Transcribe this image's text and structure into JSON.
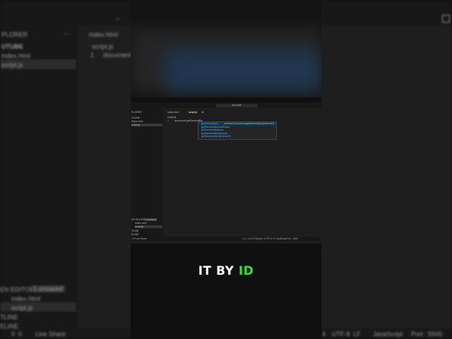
{
  "background": {
    "explorer_title": "PLORER",
    "folder_name": "UTUBE",
    "files": [
      "index.html",
      "script.js"
    ],
    "tab_label": "index.html",
    "breadcrumb": "script.js",
    "line_number": "1",
    "code": "document.",
    "open_editors_label": "EN EDITORS",
    "unsaved_badge": "1 unsaved",
    "open_editors_files": [
      "index.html",
      "script.js"
    ],
    "outline_label": "TLINE",
    "timeline_label": "ELINE",
    "status_left": [
      "0",
      "0",
      "Live Share"
    ],
    "status_right": [
      "4",
      "UTF-8",
      "LF",
      "JavaScript",
      "Port : 5500"
    ]
  },
  "inner": {
    "command_center": "YouTube",
    "explorer_title": "PLORER",
    "folder_name": "UTUBE",
    "files": [
      "index.html",
      "script.js"
    ],
    "tabs": [
      "index.html",
      "script.js"
    ],
    "breadcrumb": "script.js",
    "line_number": "1",
    "code": "document.getElementByI",
    "suggestions": [
      {
        "label": "getElementById",
        "detail": "(method) Document.getElementById(elementId..."
      },
      {
        "label": "getElementsByClassName",
        "detail": ""
      },
      {
        "label": "getElementsByName",
        "detail": ""
      },
      {
        "label": "getElementsByTagName",
        "detail": ""
      },
      {
        "label": "getElementsByTagNameNS",
        "detail": ""
      }
    ],
    "open_editors_label": "EN EDITORS",
    "unsaved_badge": "1 unsaved",
    "open_editors_files": [
      "index.html",
      "script.js"
    ],
    "outline_label": "TLINE",
    "timeline_label": "ELINE",
    "status_left": "0  0  Live Share",
    "status_right": "Ln 1, Col 23   Spaces: 4   UTF-8   LF   JavaScript   Port : 5500"
  },
  "caption": {
    "prefix": "IT BY ",
    "highlight": "ID",
    "highlight_color": "#35e03a"
  }
}
